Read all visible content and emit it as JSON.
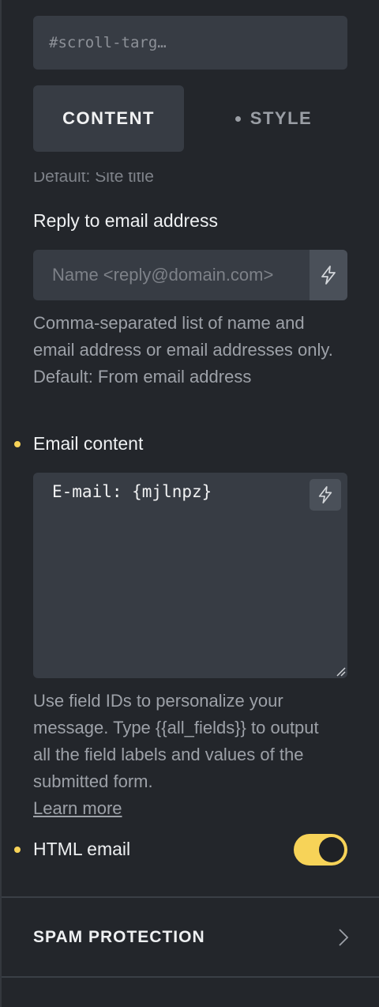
{
  "id_field": {
    "value": "#scroll-targ…"
  },
  "tabs": [
    {
      "label": "CONTENT",
      "active": true
    },
    {
      "label": "STYLE",
      "active": false
    }
  ],
  "clipped_text": "Default: Site title",
  "reply_to": {
    "label": "Reply to email address",
    "placeholder": "Name <reply@domain.com>",
    "help": "Comma-separated list of name and email address or email addresses only. Default: From email address"
  },
  "email_content": {
    "label": "Email content",
    "value": "E-mail: {mjlnpz}",
    "help": "Use field IDs to personalize your message. Type {{all_fields}} to output all the field labels and values of the submitted form.",
    "link": "Learn more"
  },
  "html_email": {
    "label": "HTML email",
    "enabled": true
  },
  "spam_section": {
    "title": "SPAM PROTECTION"
  },
  "colors": {
    "accent": "#f7d358",
    "panel_bg": "#23262b",
    "field_bg": "#373c44"
  },
  "icons": [
    "lightning-icon",
    "chevron-right-icon",
    "resize-grip-icon"
  ]
}
